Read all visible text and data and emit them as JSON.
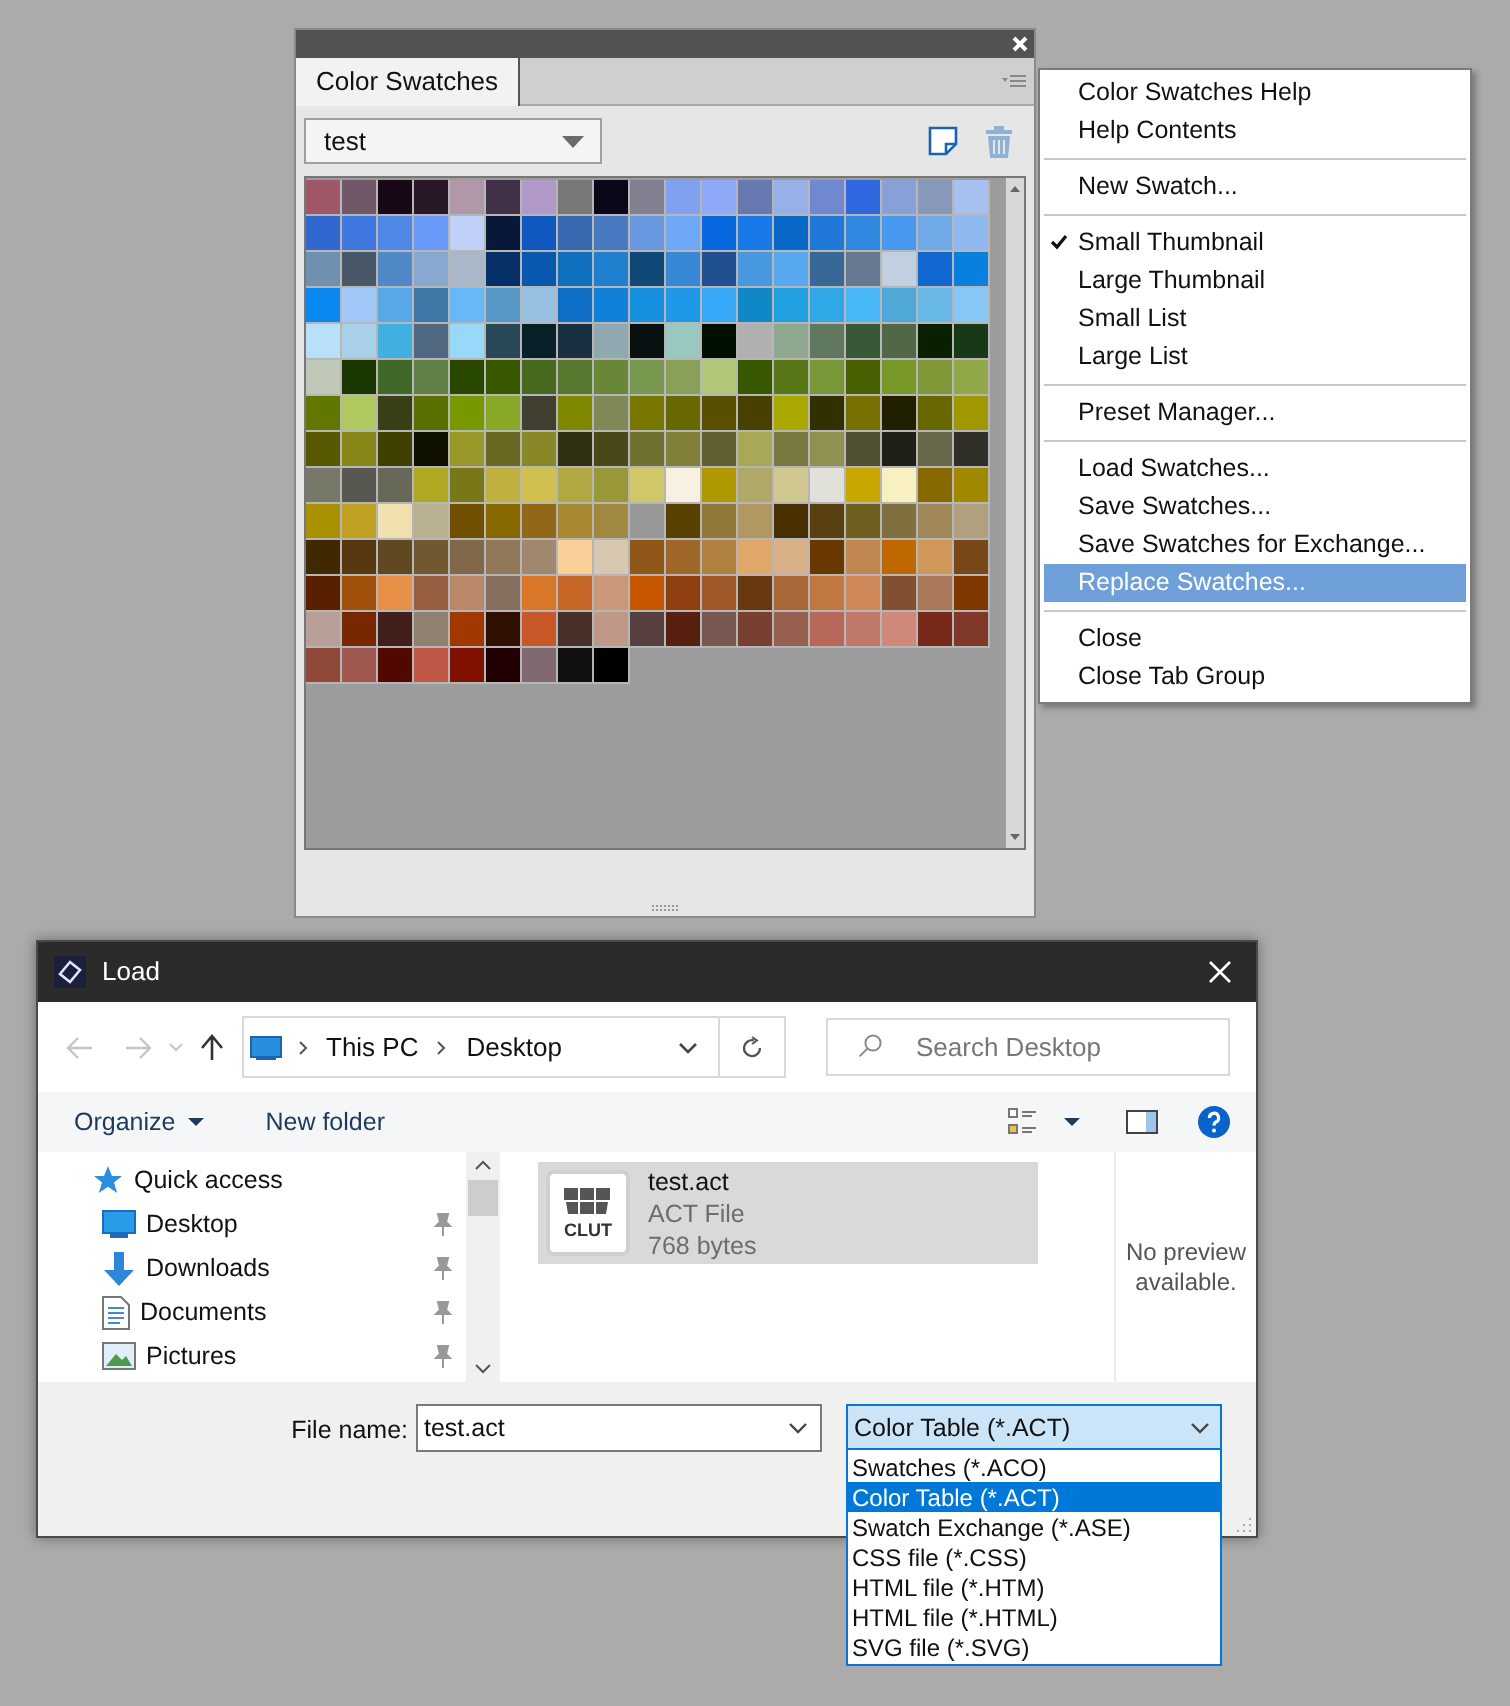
{
  "panel": {
    "tab": "Color Swatches",
    "set_dropdown": {
      "value": "test"
    },
    "swatch_rows": [
      {
        "swatches": [
          {
            "color": "#a05868"
          },
          {
            "color": "#705868"
          },
          {
            "color": "#180818"
          },
          {
            "color": "#281828"
          },
          {
            "color": "#b098a8"
          },
          {
            "color": "#403048"
          },
          {
            "color": "#b098c8"
          },
          {
            "color": "#787878"
          },
          {
            "color": "#080818"
          },
          {
            "color": "#808090"
          },
          {
            "color": "#80a0f0"
          },
          {
            "color": "#90a8f8"
          },
          {
            "color": "#6878b0"
          },
          {
            "color": "#98b0e8"
          },
          {
            "color": "#7088d0"
          },
          {
            "color": "#3068e0"
          },
          {
            "color": "#88a0d8"
          },
          {
            "color": "#8898b8"
          },
          {
            "color": "#a8c0f0"
          }
        ]
      },
      {
        "swatches": [
          {
            "color": "#3068d0"
          },
          {
            "color": "#4078e0"
          },
          {
            "color": "#5088e8"
          },
          {
            "color": "#6898f8"
          },
          {
            "color": "#c0d0f8"
          },
          {
            "color": "#081838"
          },
          {
            "color": "#1058c0"
          },
          {
            "color": "#3868b0"
          },
          {
            "color": "#4878c0"
          },
          {
            "color": "#6898e0"
          },
          {
            "color": "#70a8f8"
          },
          {
            "color": "#0868e0"
          },
          {
            "color": "#1878e8"
          },
          {
            "color": "#0868c8"
          },
          {
            "color": "#2078d8"
          },
          {
            "color": "#3088e0"
          },
          {
            "color": "#4898f0"
          },
          {
            "color": "#70a8e8"
          },
          {
            "color": "#90b8f0"
          }
        ]
      },
      {
        "swatches": [
          {
            "color": "#7090b0"
          },
          {
            "color": "#485868"
          },
          {
            "color": "#5088c8"
          },
          {
            "color": "#88a8d0"
          },
          {
            "color": "#a8b8c8"
          },
          {
            "color": "#083068"
          },
          {
            "color": "#0858b0"
          },
          {
            "color": "#1070c0"
          },
          {
            "color": "#2080d0"
          },
          {
            "color": "#104878"
          },
          {
            "color": "#3888d8"
          },
          {
            "color": "#205090"
          },
          {
            "color": "#4898e0"
          },
          {
            "color": "#58a8f0"
          },
          {
            "color": "#386898"
          },
          {
            "color": "#687890"
          },
          {
            "color": "#c0d0e0"
          },
          {
            "color": "#1068d0"
          },
          {
            "color": "#0880e0"
          }
        ]
      },
      {
        "swatches": [
          {
            "color": "#0888f0"
          },
          {
            "color": "#a0c8f8"
          },
          {
            "color": "#58a8e8"
          },
          {
            "color": "#4078a8"
          },
          {
            "color": "#68b8f8"
          },
          {
            "color": "#5898c8"
          },
          {
            "color": "#98c0e0"
          },
          {
            "color": "#1070c8"
          },
          {
            "color": "#1080d8"
          },
          {
            "color": "#1890e0"
          },
          {
            "color": "#2098e8"
          },
          {
            "color": "#38a8f8"
          },
          {
            "color": "#1088c8"
          },
          {
            "color": "#20a0e0"
          },
          {
            "color": "#30a8e8"
          },
          {
            "color": "#48b8f8"
          },
          {
            "color": "#50a8d8"
          },
          {
            "color": "#68b8e8"
          },
          {
            "color": "#88c8f8"
          }
        ]
      },
      {
        "swatches": [
          {
            "color": "#b8e0f8"
          },
          {
            "color": "#a8d0e8"
          },
          {
            "color": "#40b0e0"
          },
          {
            "color": "#506880"
          },
          {
            "color": "#98d8f8"
          },
          {
            "color": "#284858"
          },
          {
            "color": "#082028"
          },
          {
            "color": "#183040"
          },
          {
            "color": "#90a8b0"
          },
          {
            "color": "#081010"
          },
          {
            "color": "#98c8c0"
          },
          {
            "color": "#001000"
          },
          {
            "color": "#b0b0b0"
          },
          {
            "color": "#90a890"
          },
          {
            "color": "#607860"
          },
          {
            "color": "#385838"
          },
          {
            "color": "#506848"
          },
          {
            "color": "#082000"
          },
          {
            "color": "#183818"
          }
        ]
      },
      {
        "swatches": [
          {
            "color": "#c0c8b8"
          },
          {
            "color": "#183800"
          },
          {
            "color": "#406828"
          },
          {
            "color": "#608048"
          },
          {
            "color": "#284800"
          },
          {
            "color": "#385800"
          },
          {
            "color": "#486820"
          },
          {
            "color": "#587830"
          },
          {
            "color": "#688838"
          },
          {
            "color": "#789850"
          },
          {
            "color": "#88a058"
          },
          {
            "color": "#b0c878"
          },
          {
            "color": "#385800"
          },
          {
            "color": "#587818"
          },
          {
            "color": "#789838"
          },
          {
            "color": "#486000"
          },
          {
            "color": "#789828"
          },
          {
            "color": "#809838"
          },
          {
            "color": "#90a848"
          }
        ]
      },
      {
        "swatches": [
          {
            "color": "#607800"
          },
          {
            "color": "#b0c860"
          },
          {
            "color": "#384018"
          },
          {
            "color": "#587000"
          },
          {
            "color": "#789800"
          },
          {
            "color": "#88a828"
          },
          {
            "color": "#404030"
          },
          {
            "color": "#808800"
          },
          {
            "color": "#808858"
          },
          {
            "color": "#787800"
          },
          {
            "color": "#686800"
          },
          {
            "color": "#585000"
          },
          {
            "color": "#484000"
          },
          {
            "color": "#a8a800"
          },
          {
            "color": "#303000"
          },
          {
            "color": "#787000"
          },
          {
            "color": "#202000"
          },
          {
            "color": "#686800"
          },
          {
            "color": "#a09800"
          }
        ]
      },
      {
        "swatches": [
          {
            "color": "#585800"
          },
          {
            "color": "#888818"
          },
          {
            "color": "#404000"
          },
          {
            "color": "#101000"
          },
          {
            "color": "#989828"
          },
          {
            "color": "#686820"
          },
          {
            "color": "#888828"
          },
          {
            "color": "#303010"
          },
          {
            "color": "#484818"
          },
          {
            "color": "#707030"
          },
          {
            "color": "#808038"
          },
          {
            "color": "#606030"
          },
          {
            "color": "#a8a858"
          },
          {
            "color": "#787840"
          },
          {
            "color": "#909050"
          },
          {
            "color": "#505030"
          },
          {
            "color": "#202018"
          },
          {
            "color": "#686848"
          },
          {
            "color": "#303028"
          }
        ]
      },
      {
        "swatches": [
          {
            "color": "#787868"
          },
          {
            "color": "#585850"
          },
          {
            "color": "#686858"
          },
          {
            "color": "#b0a820"
          },
          {
            "color": "#787818"
          },
          {
            "color": "#c0b040"
          },
          {
            "color": "#d0c050"
          },
          {
            "color": "#b0a840"
          },
          {
            "color": "#989838"
          },
          {
            "color": "#d0c868"
          },
          {
            "color": "#f8f0e0"
          },
          {
            "color": "#b09800"
          },
          {
            "color": "#b0a868"
          },
          {
            "color": "#d0c890"
          },
          {
            "color": "#e0e0d8"
          },
          {
            "color": "#c8a800"
          },
          {
            "color": "#f8f0c0"
          },
          {
            "color": "#886800"
          },
          {
            "color": "#a08800"
          }
        ]
      },
      {
        "swatches": [
          {
            "color": "#a89000"
          },
          {
            "color": "#c0a020"
          },
          {
            "color": "#f0e0b0"
          },
          {
            "color": "#b8b090"
          },
          {
            "color": "#705000"
          },
          {
            "color": "#886800"
          },
          {
            "color": "#906818"
          },
          {
            "color": "#a88830"
          },
          {
            "color": "#a08840"
          },
          {
            "color": "#989898"
          },
          {
            "color": "#584000"
          },
          {
            "color": "#907838"
          },
          {
            "color": "#b09860"
          },
          {
            "color": "#483000"
          },
          {
            "color": "#584010"
          },
          {
            "color": "#706020"
          },
          {
            "color": "#807040"
          },
          {
            "color": "#a08858"
          },
          {
            "color": "#b0a080"
          }
        ]
      },
      {
        "swatches": [
          {
            "color": "#402800"
          },
          {
            "color": "#583810"
          },
          {
            "color": "#604820"
          },
          {
            "color": "#705830"
          },
          {
            "color": "#806848"
          },
          {
            "color": "#907858"
          },
          {
            "color": "#a08870"
          },
          {
            "color": "#f8d098"
          },
          {
            "color": "#d8c8b0"
          },
          {
            "color": "#905818"
          },
          {
            "color": "#a06828"
          },
          {
            "color": "#b08040"
          },
          {
            "color": "#e0a868"
          },
          {
            "color": "#d8b088"
          },
          {
            "color": "#683800"
          },
          {
            "color": "#c08850"
          },
          {
            "color": "#c06800"
          },
          {
            "color": "#d09858"
          },
          {
            "color": "#784818"
          }
        ]
      },
      {
        "swatches": [
          {
            "color": "#582000"
          },
          {
            "color": "#a05008"
          },
          {
            "color": "#e89048"
          },
          {
            "color": "#986040"
          },
          {
            "color": "#b88868"
          },
          {
            "color": "#887060"
          },
          {
            "color": "#d87828"
          },
          {
            "color": "#c86828"
          },
          {
            "color": "#c89878"
          },
          {
            "color": "#c85800"
          },
          {
            "color": "#904010"
          },
          {
            "color": "#a05828"
          },
          {
            "color": "#683810"
          },
          {
            "color": "#a86838"
          },
          {
            "color": "#c07840"
          },
          {
            "color": "#d08858"
          },
          {
            "color": "#805030"
          },
          {
            "color": "#a87858"
          },
          {
            "color": "#803800"
          }
        ]
      },
      {
        "swatches": [
          {
            "color": "#b8a098"
          },
          {
            "color": "#782800"
          },
          {
            "color": "#402018"
          },
          {
            "color": "#908070"
          },
          {
            "color": "#a03800"
          },
          {
            "color": "#301000"
          },
          {
            "color": "#c85828"
          },
          {
            "color": "#483028"
          },
          {
            "color": "#c09888"
          },
          {
            "color": "#584040"
          },
          {
            "color": "#582010"
          },
          {
            "color": "#785850"
          },
          {
            "color": "#784030"
          },
          {
            "color": "#986050"
          },
          {
            "color": "#b86858"
          },
          {
            "color": "#c07868"
          },
          {
            "color": "#d08878"
          },
          {
            "color": "#782818"
          },
          {
            "color": "#803828"
          }
        ]
      },
      {
        "swatches": [
          {
            "color": "#904838"
          },
          {
            "color": "#a05850"
          },
          {
            "color": "#500800"
          },
          {
            "color": "#c05848"
          },
          {
            "color": "#801000"
          },
          {
            "color": "#200000"
          },
          {
            "color": "#806870"
          },
          {
            "color": "#101010"
          },
          {
            "color": "#000000"
          }
        ]
      }
    ]
  },
  "flyout_menu": {
    "groups": [
      {
        "items": [
          {
            "label": "Color Swatches Help",
            "checked": false,
            "selected": false
          },
          {
            "label": "Help Contents",
            "checked": false,
            "selected": false
          }
        ]
      },
      {
        "items": [
          {
            "label": "New Swatch...",
            "checked": false,
            "selected": false
          }
        ]
      },
      {
        "items": [
          {
            "label": "Small Thumbnail",
            "checked": true,
            "selected": false
          },
          {
            "label": "Large Thumbnail",
            "checked": false,
            "selected": false
          },
          {
            "label": "Small List",
            "checked": false,
            "selected": false
          },
          {
            "label": "Large List",
            "checked": false,
            "selected": false
          }
        ]
      },
      {
        "items": [
          {
            "label": "Preset Manager...",
            "checked": false,
            "selected": false
          }
        ]
      },
      {
        "items": [
          {
            "label": "Load Swatches...",
            "checked": false,
            "selected": false
          },
          {
            "label": "Save Swatches...",
            "checked": false,
            "selected": false
          },
          {
            "label": "Save Swatches for Exchange...",
            "checked": false,
            "selected": false
          },
          {
            "label": "Replace Swatches...",
            "checked": false,
            "selected": true
          }
        ]
      },
      {
        "items": [
          {
            "label": "Close",
            "checked": false,
            "selected": false
          },
          {
            "label": "Close Tab Group",
            "checked": false,
            "selected": false
          }
        ]
      }
    ]
  },
  "load_dialog": {
    "title": "Load",
    "breadcrumb": [
      "This PC",
      "Desktop"
    ],
    "search": {
      "placeholder": "Search Desktop"
    },
    "toolbar": [
      "Organize",
      "New folder"
    ],
    "nav": [
      {
        "label": "Quick access",
        "kind": "star",
        "pinned": false,
        "children": [
          {
            "label": "Desktop",
            "kind": "desktop",
            "pinned": true
          },
          {
            "label": "Downloads",
            "kind": "download",
            "pinned": true
          },
          {
            "label": "Documents",
            "kind": "document",
            "pinned": true
          },
          {
            "label": "Pictures",
            "kind": "picture",
            "pinned": true
          }
        ]
      }
    ],
    "files": [
      {
        "name": "test.act",
        "type": "ACT File",
        "size": "768 bytes",
        "icon_label": "CLUT",
        "selected": true
      }
    ],
    "preview": "No preview available.",
    "file_name": {
      "label": "File name:",
      "value": "test.act"
    },
    "file_type": {
      "value": "Color Table (*.ACT)",
      "options": [
        {
          "label": "Swatches (*.ACO)",
          "selected": false
        },
        {
          "label": "Color Table (*.ACT)",
          "selected": true
        },
        {
          "label": "Swatch Exchange (*.ASE)",
          "selected": false
        },
        {
          "label": "CSS file (*.CSS)",
          "selected": false
        },
        {
          "label": "HTML file (*.HTM)",
          "selected": false
        },
        {
          "label": "HTML file (*.HTML)",
          "selected": false
        },
        {
          "label": "SVG file (*.SVG)",
          "selected": false
        }
      ]
    }
  }
}
